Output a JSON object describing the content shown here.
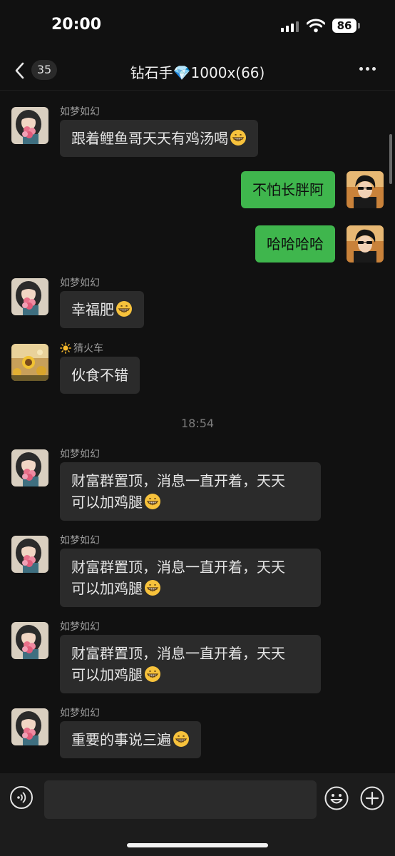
{
  "status_bar": {
    "time": "20:00",
    "battery": "86"
  },
  "header": {
    "unread_count": "35",
    "title": "钻石手💎1000x(66)"
  },
  "messages": [
    {
      "sender": "如梦如幻",
      "text": "跟着鲤鱼哥天天有鸡汤喝",
      "emoji": "grinning-face-emoji"
    },
    {
      "text": "不怕长胖阿"
    },
    {
      "text": "哈哈哈哈"
    },
    {
      "sender": "如梦如幻",
      "text": "幸福肥",
      "emoji": "grinning-face-emoji"
    },
    {
      "sender": "猜火车",
      "sender_icon": "sun-icon",
      "text": "伙食不错"
    },
    {
      "sender": "如梦如幻",
      "line1": "财富群置顶，消息一直开着，天天",
      "line2": "可以加鸡腿",
      "emoji": "grinning-face-emoji"
    },
    {
      "sender": "如梦如幻",
      "line1": "财富群置顶，消息一直开着，天天",
      "line2": "可以加鸡腿",
      "emoji": "grinning-face-emoji"
    },
    {
      "sender": "如梦如幻",
      "line1": "财富群置顶，消息一直开着，天天",
      "line2": "可以加鸡腿",
      "emoji": "grinning-face-emoji"
    },
    {
      "sender": "如梦如幻",
      "text": "重要的事说三遍",
      "emoji": "grinning-face-emoji"
    }
  ],
  "timestamp": "18:54",
  "colors": {
    "outgoing_bubble": "#3fb64d",
    "incoming_bubble": "#2b2b2b",
    "background": "#111111"
  }
}
